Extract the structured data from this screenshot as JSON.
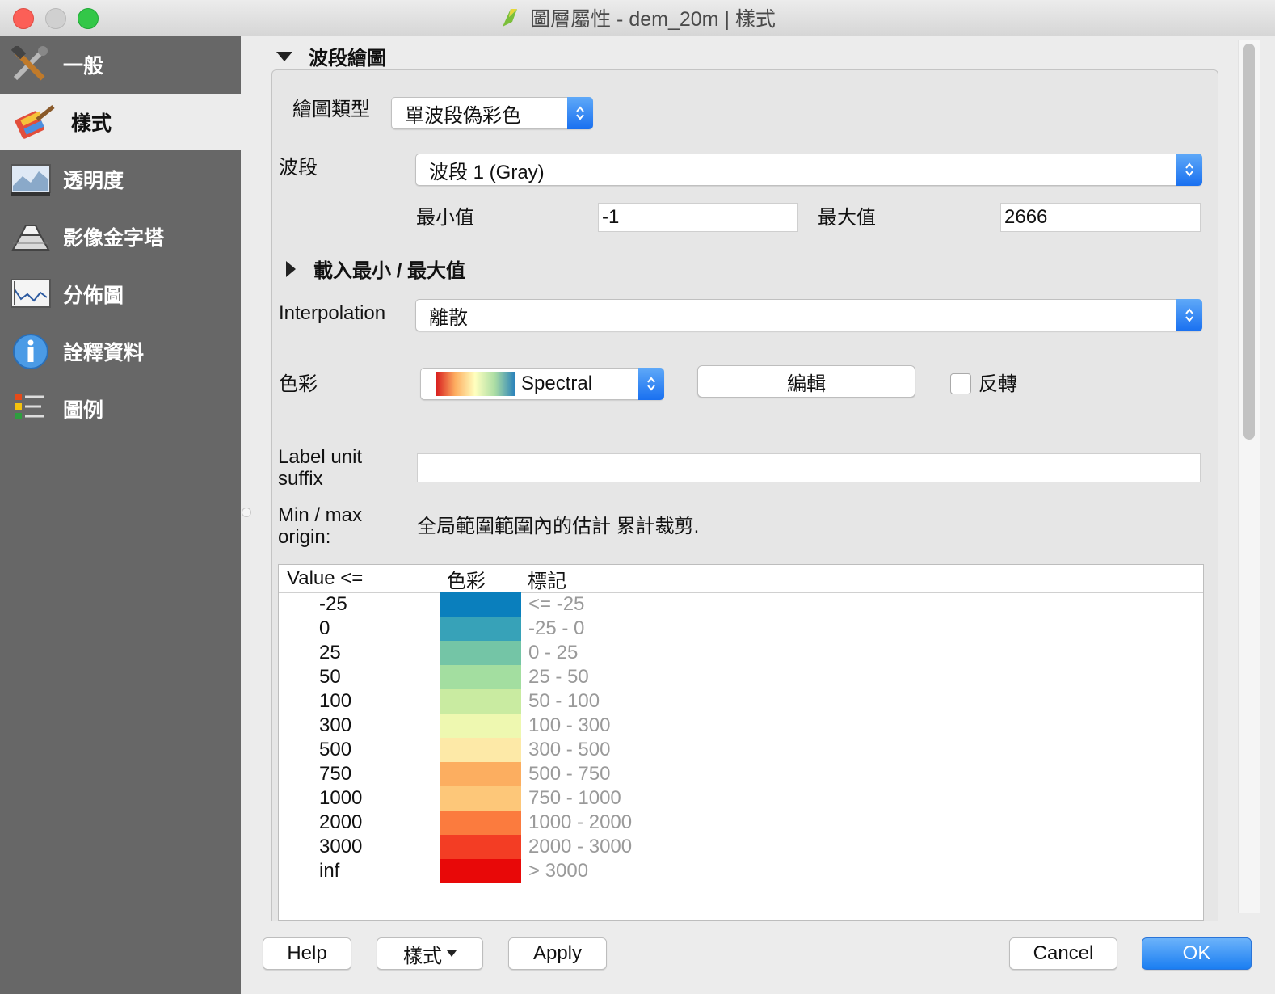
{
  "window": {
    "title": "圖層屬性 - dem_20m | 樣式"
  },
  "sidebar": {
    "items": [
      {
        "label": "一般",
        "icon": "tools-icon"
      },
      {
        "label": "樣式",
        "icon": "paintbrush-icon",
        "selected": true
      },
      {
        "label": "透明度",
        "icon": "transparency-icon"
      },
      {
        "label": "影像金字塔",
        "icon": "pyramid-icon"
      },
      {
        "label": "分佈圖",
        "icon": "histogram-icon"
      },
      {
        "label": "詮釋資料",
        "icon": "info-icon"
      },
      {
        "label": "圖例",
        "icon": "legend-icon"
      }
    ]
  },
  "band_rendering": {
    "section_title": "波段繪圖",
    "render_type_label": "繪圖類型",
    "render_type_value": "單波段偽彩色",
    "band_label": "波段",
    "band_value": "波段 1 (Gray)",
    "min_label": "最小值",
    "min_value": "-1",
    "max_label": "最大值",
    "max_value": "2666",
    "load_minmax_label": "載入最小 / 最大值",
    "interpolation_label": "Interpolation",
    "interpolation_value": "離散",
    "color_label": "色彩",
    "color_ramp_value": "Spectral",
    "edit_button": "編輯",
    "invert_label": "反轉",
    "label_suffix_label": "Label unit suffix",
    "label_suffix_value": "",
    "minmax_origin_label": "Min / max origin:",
    "minmax_origin_value": "全局範圍範圍內的估計 累計裁剪."
  },
  "table": {
    "headers": [
      "Value <=",
      "色彩",
      "標記"
    ],
    "rows": [
      {
        "value": "-25",
        "color": "#0a7fbd",
        "label": "<= -25"
      },
      {
        "value": "0",
        "color": "#37a2b8",
        "label": "-25 - 0"
      },
      {
        "value": "25",
        "color": "#74c5a6",
        "label": "0 - 25"
      },
      {
        "value": "50",
        "color": "#a3dea0",
        "label": "25 - 50"
      },
      {
        "value": "100",
        "color": "#c9eba1",
        "label": "50 - 100"
      },
      {
        "value": "300",
        "color": "#eef8b0",
        "label": "100 - 300"
      },
      {
        "value": "500",
        "color": "#fde9a7",
        "label": "300 - 500"
      },
      {
        "value": "750",
        "color": "#fcae60",
        "label": "500 - 750"
      },
      {
        "value": "1000",
        "color": "#fdc779",
        "label": "750 - 1000"
      },
      {
        "value": "2000",
        "color": "#fb7b3e",
        "label": "1000 - 2000"
      },
      {
        "value": "3000",
        "color": "#f33d24",
        "label": "2000 - 3000"
      },
      {
        "value": "inf",
        "color": "#e80808",
        "label": "> 3000"
      }
    ]
  },
  "buttons": {
    "help": "Help",
    "style": "樣式",
    "apply": "Apply",
    "cancel": "Cancel",
    "ok": "OK"
  },
  "colors": {
    "accent": "#1a7ef2",
    "sidebar_bg": "#676767"
  }
}
